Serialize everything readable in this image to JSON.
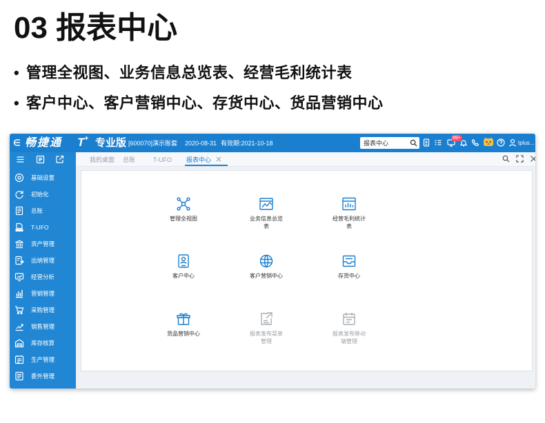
{
  "slide": {
    "title": "03 报表中心",
    "bullets": [
      "管理全视图、业务信息总览表、经营毛利统计表",
      "客户中心、客户营销中心、存货中心、货品营销中心"
    ]
  },
  "app": {
    "header": {
      "logo": "畅捷通",
      "product": "T",
      "product_sup": "+",
      "edition": "专业版",
      "account": "[600070]演示账套",
      "date": "2020-08-31",
      "validity": "有效期:2021-10-18",
      "search_value": "报表中心",
      "notification_badge": "99+",
      "user": "tplus..."
    },
    "tabs": [
      {
        "label": "我的桌面"
      },
      {
        "label": "总账"
      },
      {
        "label": "T-UFO"
      },
      {
        "label": "报表中心",
        "active": true
      }
    ],
    "sidebar": {
      "items": [
        {
          "label": "基础设置",
          "icon": "settings-icon"
        },
        {
          "label": "初始化",
          "icon": "refresh-icon"
        },
        {
          "label": "总账",
          "icon": "ledger-icon"
        },
        {
          "label": "T-UFO",
          "icon": "t-ufo-icon"
        },
        {
          "label": "资产管理",
          "icon": "bank-icon"
        },
        {
          "label": "出纳管理",
          "icon": "cashier-icon"
        },
        {
          "label": "经营分析",
          "icon": "analysis-icon"
        },
        {
          "label": "营销管理",
          "icon": "marketing-icon"
        },
        {
          "label": "采购管理",
          "icon": "cart-icon"
        },
        {
          "label": "销售管理",
          "icon": "sales-chart-icon"
        },
        {
          "label": "库存核算",
          "icon": "warehouse-icon"
        },
        {
          "label": "生产管理",
          "icon": "production-icon"
        },
        {
          "label": "委外管理",
          "icon": "outsourcing-icon"
        }
      ]
    },
    "tiles": [
      {
        "label": "管理全视图",
        "icon": "hub-icon"
      },
      {
        "label": "业务信息总览表",
        "icon": "overview-chart-icon"
      },
      {
        "label": "经营毛利统计表",
        "icon": "profit-report-icon"
      },
      {
        "label": "客户中心",
        "icon": "customer-card-icon"
      },
      {
        "label": "客户营销中心",
        "icon": "globe-icon"
      },
      {
        "label": "存货中心",
        "icon": "inbox-icon"
      },
      {
        "label": "货品营销中心",
        "icon": "gift-icon"
      },
      {
        "label": "报表发布菜单管理",
        "icon": "publish-menu-icon",
        "disabled": true
      },
      {
        "label": "报表发布移动端管理",
        "icon": "publish-mobile-icon",
        "disabled": true
      }
    ]
  },
  "colors": {
    "header_blue": "#1b7fd0",
    "sidebar_blue": "#2187d4",
    "icon_blue": "#1a7ecf",
    "disabled_gray": "#a9aeb5",
    "badge_red": "#ff4d6a"
  }
}
